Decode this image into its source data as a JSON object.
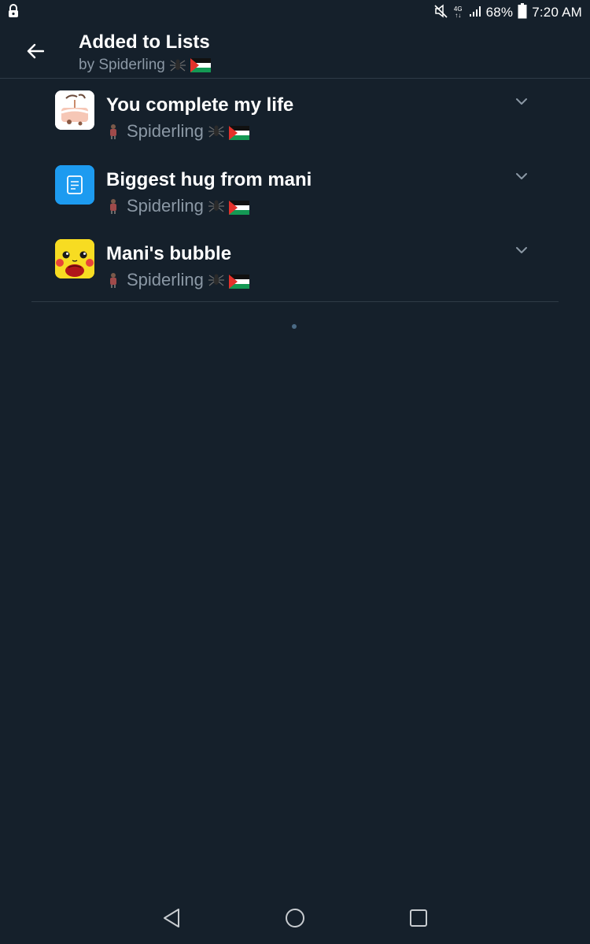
{
  "status_bar": {
    "network_type": "4G",
    "battery_percent": "68%",
    "time": "7:20 AM",
    "icons": [
      "lock-icon",
      "mute-icon",
      "signal-icon",
      "battery-icon"
    ]
  },
  "header": {
    "title": "Added to Lists",
    "subtitle": "by Spiderling"
  },
  "lists": [
    {
      "name": "You complete my life",
      "owner": "Spiderling",
      "avatar": "cake-drawing"
    },
    {
      "name": "Biggest hug from mani",
      "owner": "Spiderling",
      "avatar": "default-list-icon"
    },
    {
      "name": "Mani's bubble",
      "owner": "Spiderling",
      "avatar": "pikachu-image"
    }
  ],
  "colors": {
    "background": "#15202b",
    "muted_text": "#8b98a5",
    "divider": "#2f3b47",
    "accent_blue": "#1d9bf0"
  }
}
